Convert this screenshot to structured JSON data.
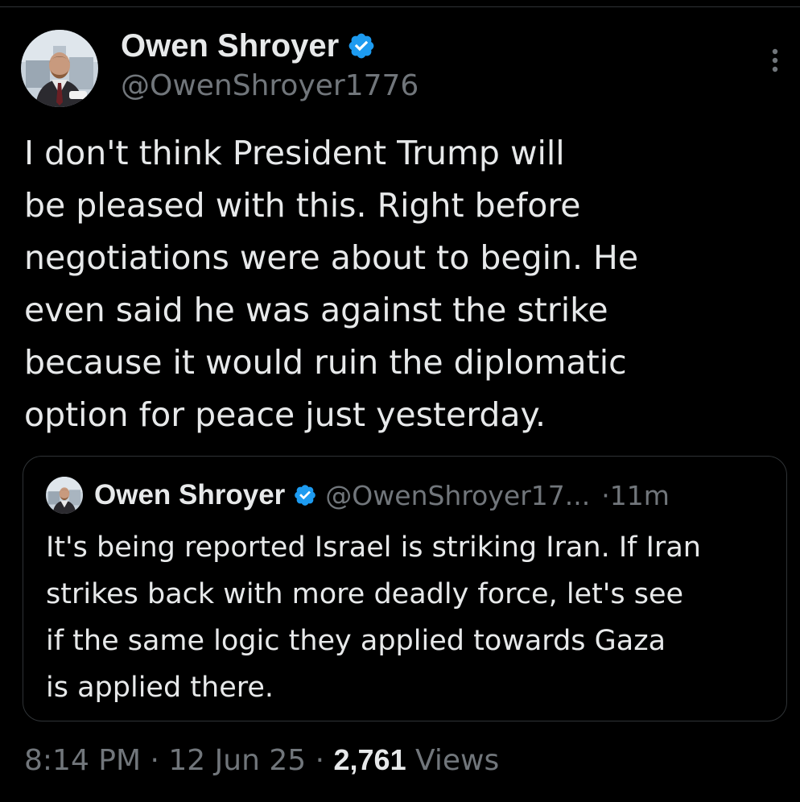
{
  "author": {
    "display_name": "Owen Shroyer",
    "handle": "@OwenShroyer1776",
    "verified_icon": "verified-badge-icon",
    "avatar_icon": "profile-photo"
  },
  "tweet": {
    "lines": [
      "I don't think President Trump will",
      "be pleased with this. Right before",
      "negotiations were about to begin. He",
      "even said he was against the strike",
      "because it would ruin the diplomatic",
      "option for peace just yesterday."
    ]
  },
  "quoted": {
    "display_name": "Owen Shroyer",
    "handle": "@OwenShroyer17...",
    "separator": "·",
    "time": "11m",
    "lines": [
      "It's being reported Israel is striking Iran. If Iran",
      "strikes back with more deadly force, let's see",
      "if the same logic they applied towards Gaza",
      "is applied there."
    ]
  },
  "meta": {
    "time": "8:14 PM",
    "sep1": " · ",
    "date": "12 Jun 25",
    "sep2": " · ",
    "views_count": "2,761",
    "views_label": " Views"
  },
  "colors": {
    "background": "#000000",
    "text": "#e7e9ea",
    "secondary": "#71767b",
    "verified": "#1d9bf0",
    "border": "#2f3336"
  },
  "icons": {
    "more": "more-vertical-icon"
  }
}
